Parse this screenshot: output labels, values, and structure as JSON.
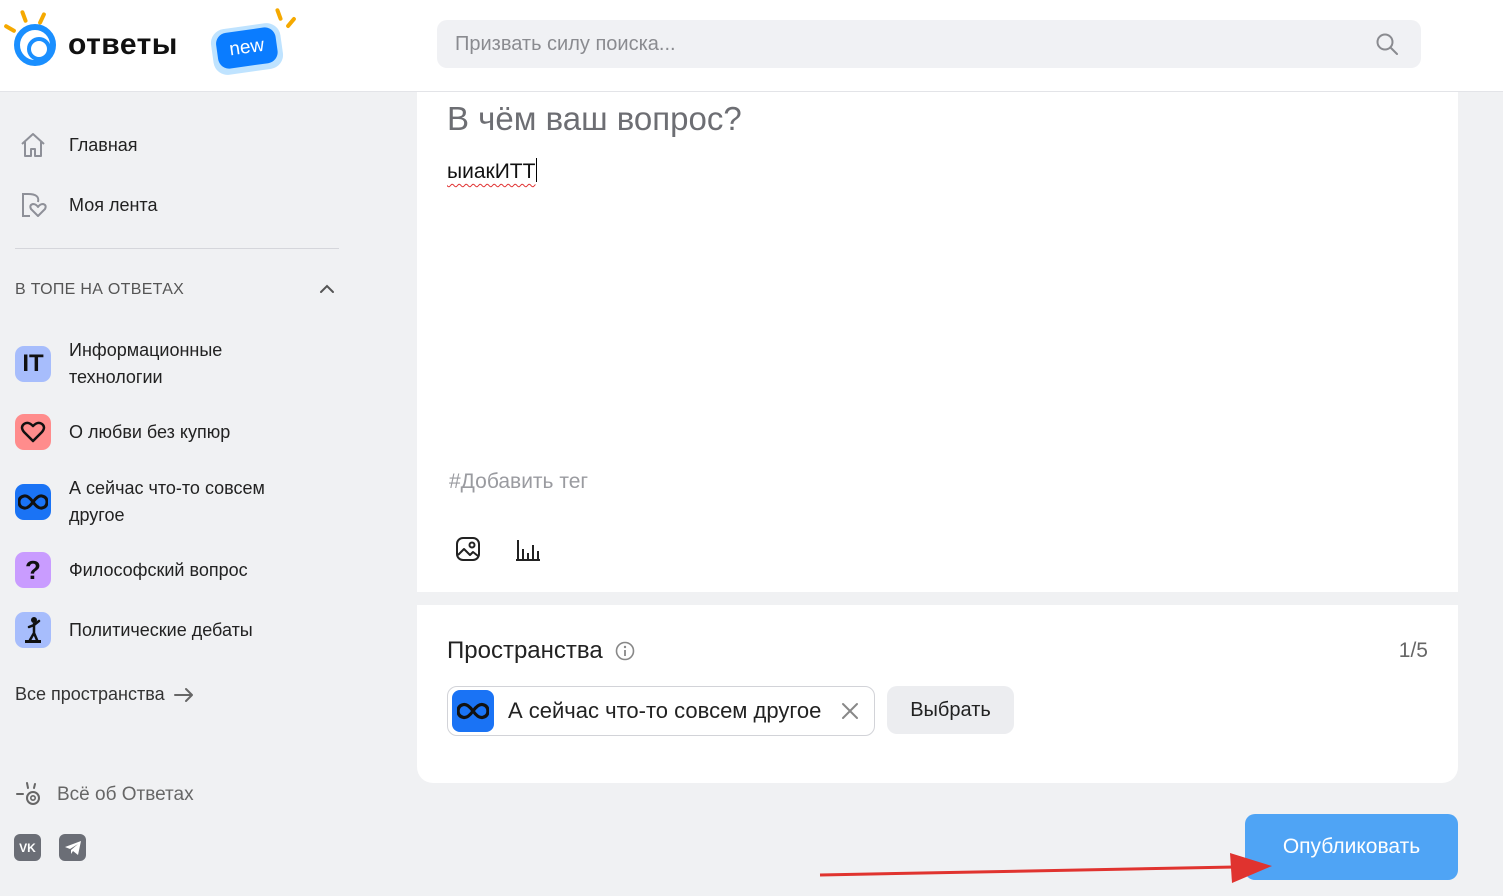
{
  "logo": {
    "text": "ответы",
    "badge": "new"
  },
  "search": {
    "placeholder": "Призвать силу поиска..."
  },
  "sidebar": {
    "nav": [
      {
        "label": "Главная",
        "icon": "home-icon"
      },
      {
        "label": "Моя лента",
        "icon": "feed-icon"
      }
    ],
    "section_title": "В ТОПЕ НА ОТВЕТАХ",
    "spaces": [
      {
        "label": "Информационные технологии",
        "icon": "it-icon",
        "color": "#a7bdfc"
      },
      {
        "label": "О любви без купюр",
        "icon": "heart-icon",
        "color": "#ff8c8c"
      },
      {
        "label": "А сейчас что-то совсем другое",
        "icon": "infinity-icon",
        "color": "#1a73f5"
      },
      {
        "label": "Философский вопрос",
        "icon": "question-icon",
        "color": "#c99cff"
      },
      {
        "label": "Политические дебаты",
        "icon": "podium-icon",
        "color": "#a7bdfc"
      }
    ],
    "all_spaces": "Все пространства",
    "about": "Всё об Ответах",
    "socials": [
      "vk-icon",
      "telegram-icon"
    ]
  },
  "question": {
    "title_placeholder": "В чём ваш вопрос?",
    "body": "ыиакИТТ",
    "tag_placeholder": "#Добавить тег"
  },
  "spaces_card": {
    "title": "Пространства",
    "count": "1/5",
    "chip_label": "А сейчас что-то совсем другое",
    "choose_label": "Выбрать"
  },
  "publish_label": "Опубликовать",
  "colors": {
    "accent": "#4fa4f5",
    "brand": "#0a7cff",
    "annotation": "#e0332f"
  }
}
